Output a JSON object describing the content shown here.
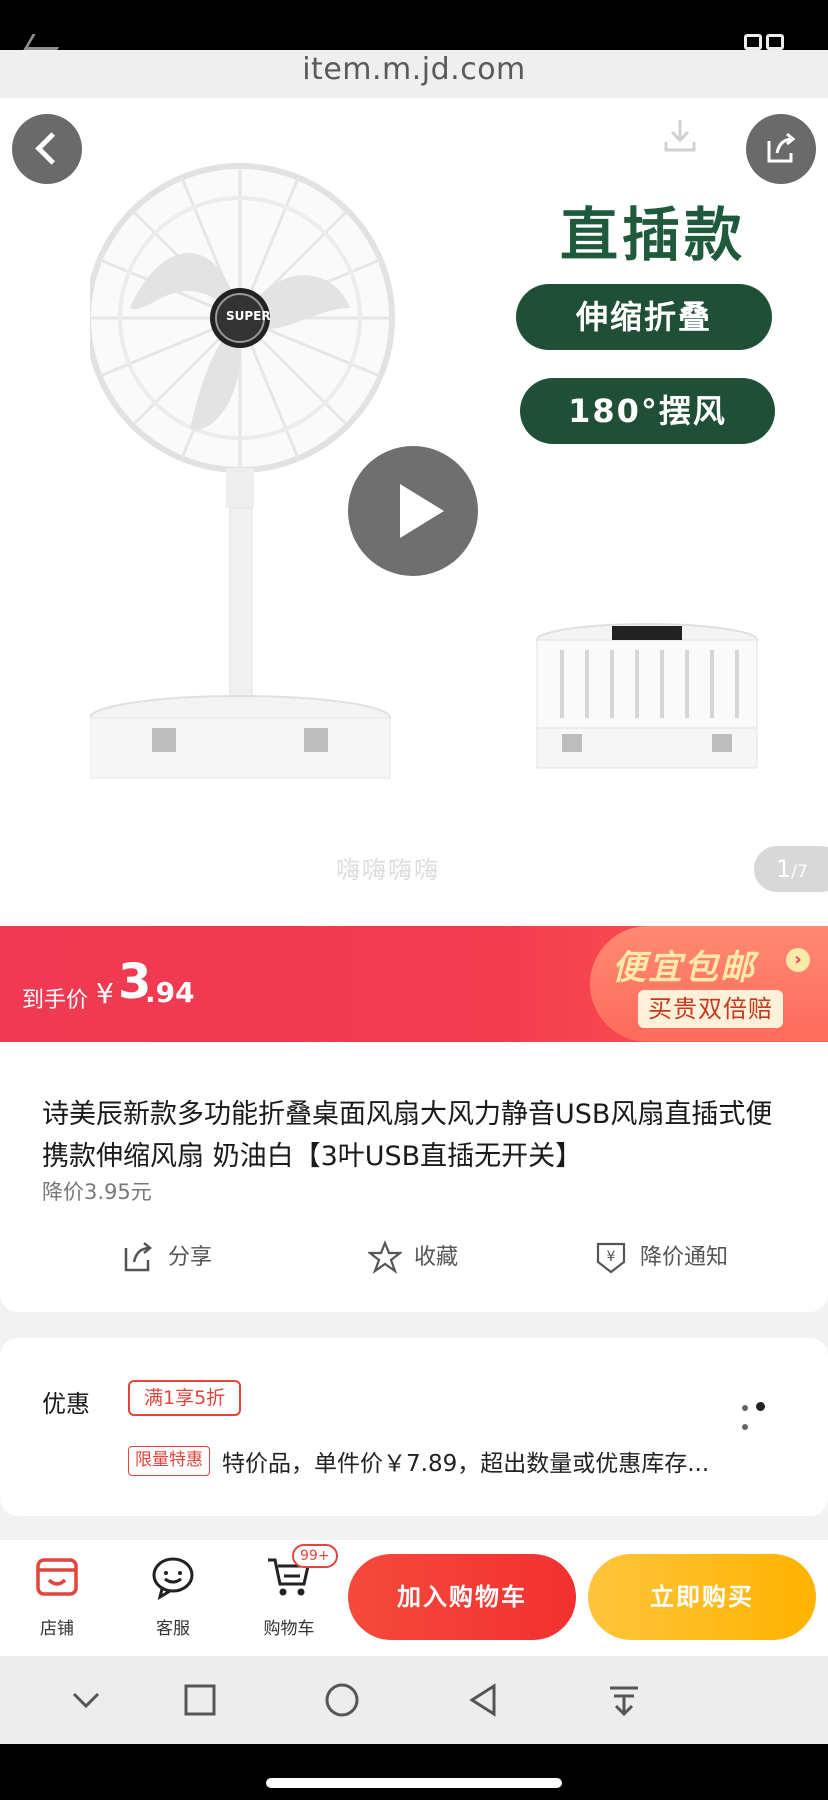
{
  "browser": {
    "url": "item.m.jd.com"
  },
  "hero": {
    "tag_big": "直插款",
    "pill_1": "伸缩折叠",
    "pill_2": "180°摆风",
    "brand_mark": "SUPER",
    "watermark": "嗨嗨嗨嗨",
    "page_current": "1",
    "page_total": "/7"
  },
  "price": {
    "label": "到手价",
    "currency": "¥",
    "integer": "3",
    "decimal": ".94",
    "free_shipping": "便宜包邮",
    "double_compensation": "买贵双倍赔"
  },
  "product": {
    "title": "诗美辰新款多功能折叠桌面风扇大风力静音USB风扇直插式便携款伸缩风扇 奶油白【3叶USB直插无开关】",
    "price_drop": "降价3.95元",
    "actions": {
      "share": "分享",
      "favorite": "收藏",
      "price_alert": "降价通知"
    }
  },
  "promo": {
    "title": "优惠",
    "badge_discount": "满1享5折",
    "badge_limited": "限量特惠",
    "description": "特价品，单件价￥7.89，超出数量或优惠库存..."
  },
  "bottom_bar": {
    "store": "店铺",
    "service": "客服",
    "cart": "购物车",
    "cart_count": "99+",
    "add_to_cart": "加入购物车",
    "buy_now": "立即购买"
  },
  "colors": {
    "accent_red": "#f23b4f",
    "button_yellow": "#ffb300",
    "pill_green": "#1f4f36"
  }
}
